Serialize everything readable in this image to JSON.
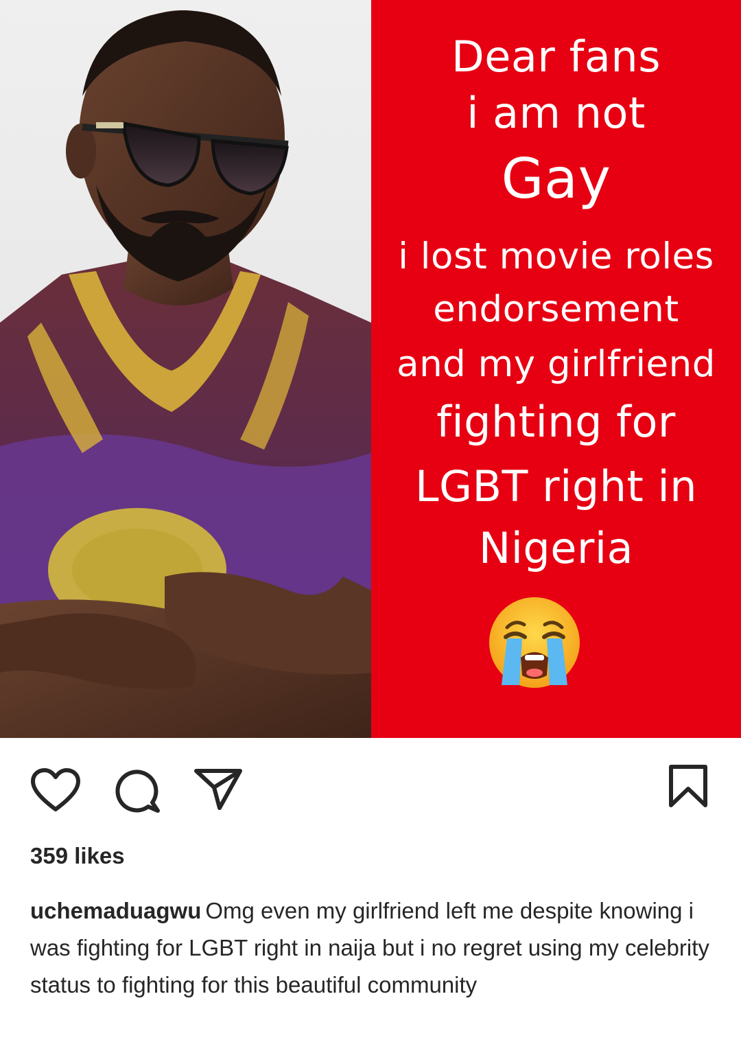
{
  "post": {
    "meme_text": {
      "line1": "Dear fans",
      "line2": "i am not",
      "line3": "Gay",
      "line4": "i lost movie roles",
      "line5": "endorsement",
      "line6": "and my girlfriend",
      "line7": "fighting for",
      "line8": "LGBT right in",
      "line9": "Nigeria"
    },
    "emoji": "loudly-crying-face",
    "likes": "359 likes",
    "username": "uchemaduagwu",
    "caption": "Omg even my girlfriend left me despite knowing i was fighting for LGBT right in naija but i no regret using my celebrity status to fighting for this beautiful community"
  },
  "actions": {
    "like_icon": "heart-icon",
    "comment_icon": "comment-icon",
    "share_icon": "share-icon",
    "save_icon": "bookmark-icon"
  },
  "colors": {
    "meme_red": "#e60012",
    "text_dark": "#262626"
  }
}
